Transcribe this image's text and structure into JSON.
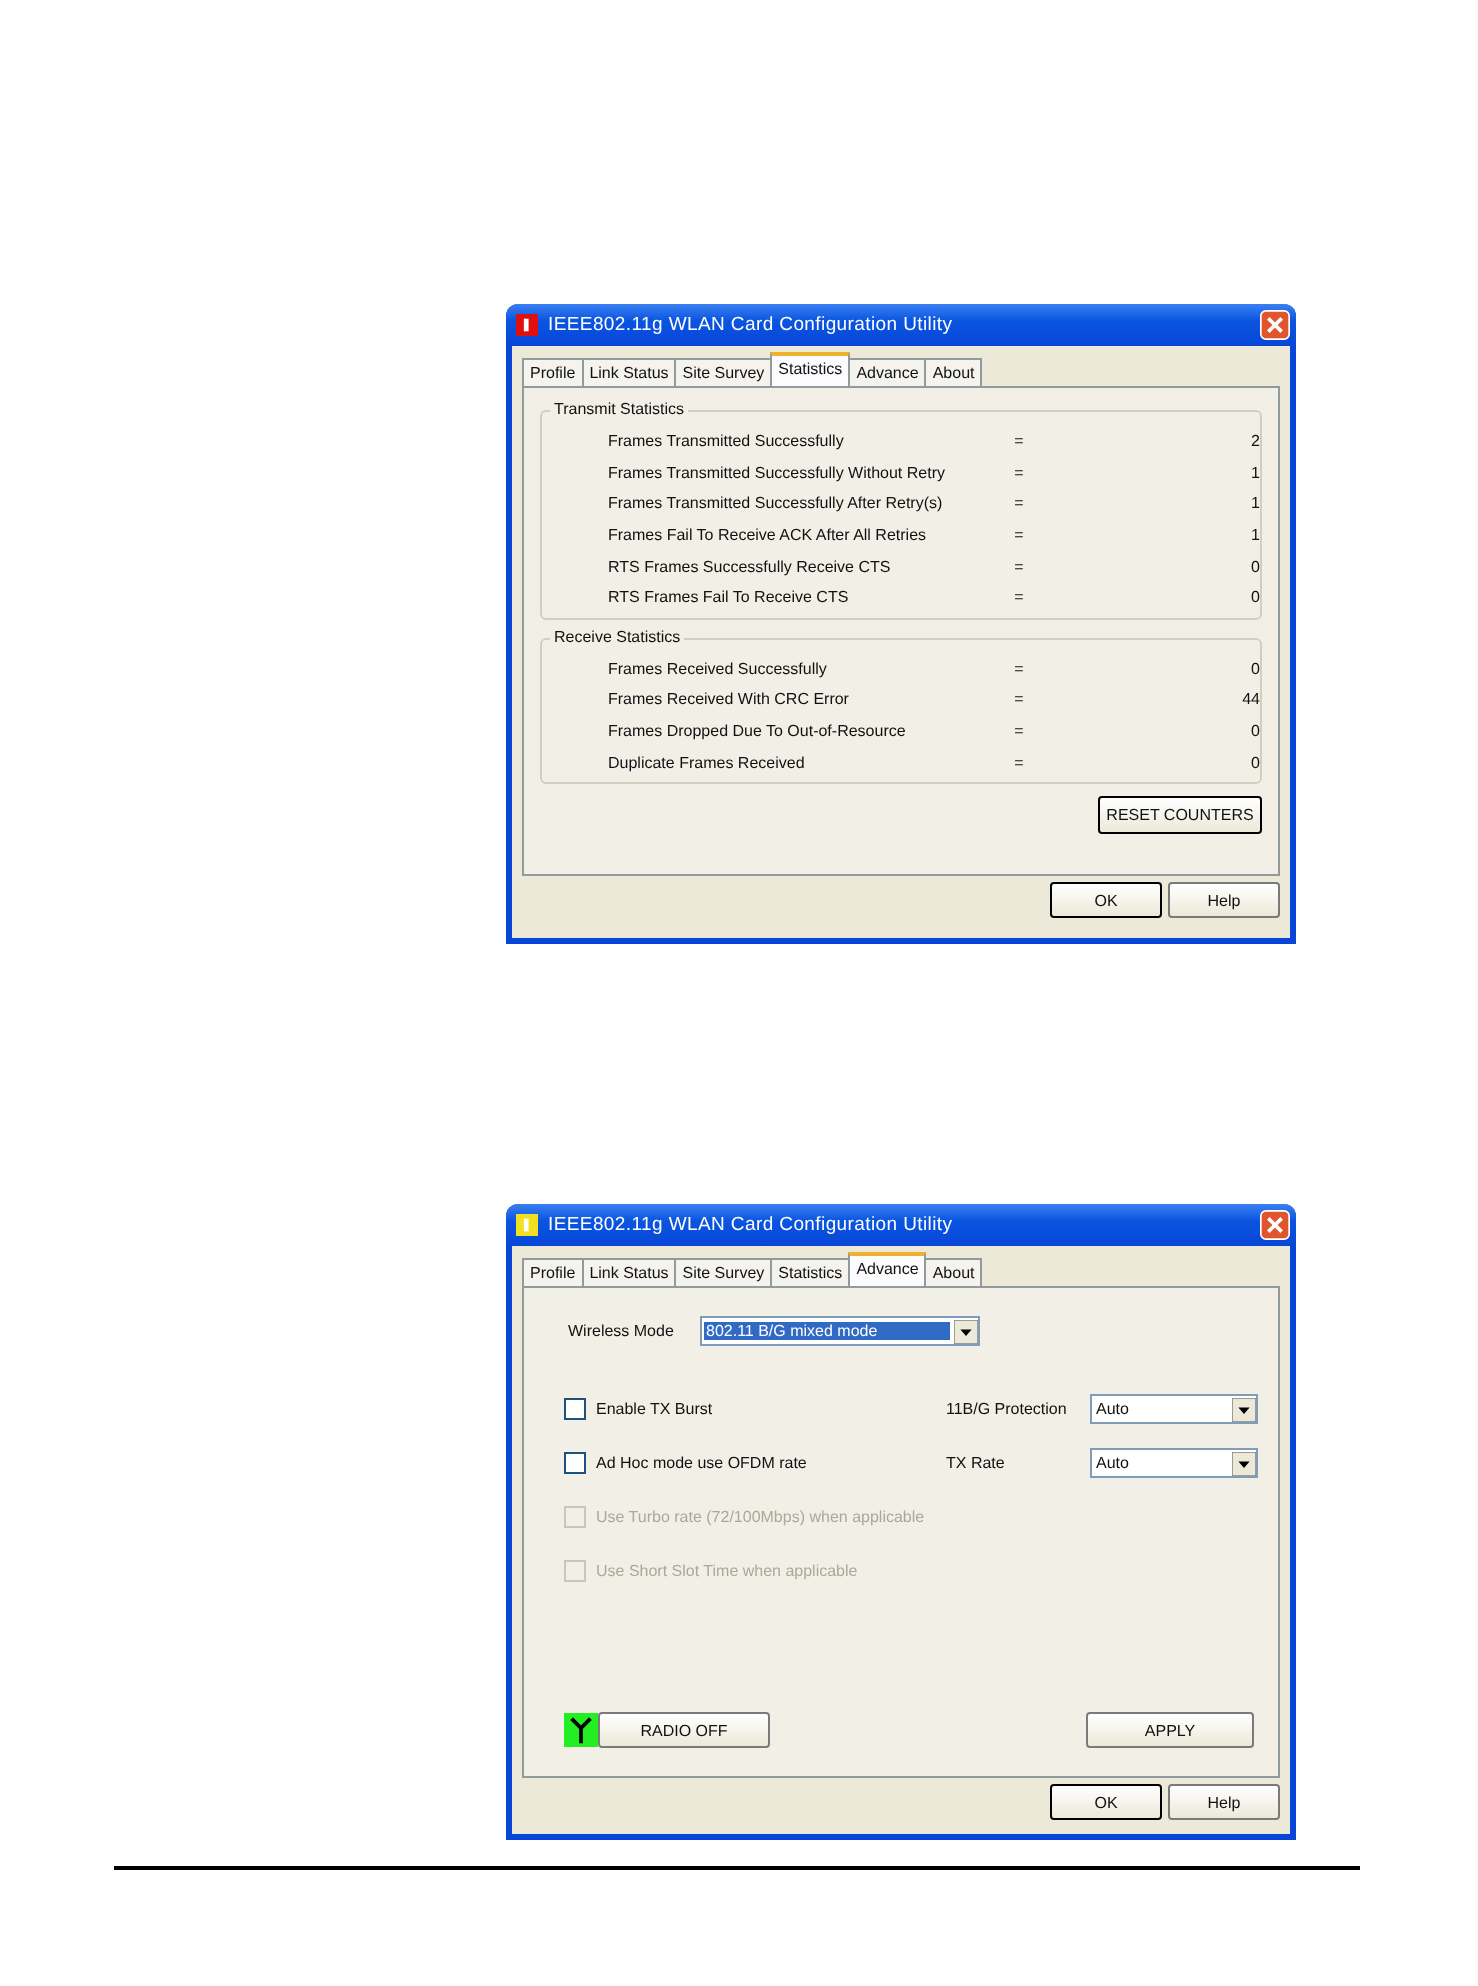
{
  "dialogs": [
    {
      "kind": "statistics",
      "title": "IEEE802.11g WLAN Card Configuration Utility",
      "color": "#e01010",
      "tabs": [
        {
          "label": "Profile",
          "selected": false
        },
        {
          "label": "Link Status",
          "selected": false
        },
        {
          "label": "Site Survey",
          "selected": false
        },
        {
          "label": "Statistics",
          "selected": true
        },
        {
          "label": "Advance",
          "selected": false
        },
        {
          "label": "About",
          "selected": false
        }
      ],
      "groups": [
        {
          "title": "Transmit Statistics",
          "rows": [
            {
              "label": "Frames Transmitted Successfully",
              "sign": "=",
              "value": "2"
            },
            {
              "label": "Frames Transmitted Successfully  Without Retry",
              "sign": "=",
              "value": "1"
            },
            {
              "label": "Frames Transmitted Successfully After Retry(s)",
              "sign": "=",
              "value": "1"
            },
            {
              "label": "Frames Fail To Receive ACK After All Retries",
              "sign": "=",
              "value": "1"
            },
            {
              "label": "RTS Frames Successfully Receive CTS",
              "sign": "=",
              "value": "0"
            },
            {
              "label": "RTS Frames Fail To Receive CTS",
              "sign": "=",
              "value": "0"
            }
          ]
        },
        {
          "title": "Receive Statistics",
          "rows": [
            {
              "label": "Frames Received Successfully",
              "sign": "=",
              "value": "0"
            },
            {
              "label": "Frames Received With CRC Error",
              "sign": "=",
              "value": "44"
            },
            {
              "label": "Frames Dropped Due To Out-of-Resource",
              "sign": "=",
              "value": "0"
            },
            {
              "label": "Duplicate Frames Received",
              "sign": "=",
              "value": "0"
            }
          ]
        }
      ],
      "reset_button": "RESET COUNTERS",
      "buttons": [
        "OK",
        "Help"
      ]
    },
    {
      "kind": "advance",
      "title": "IEEE802.11g WLAN Card Configuration Utility",
      "color": "#f0e020",
      "tabs": [
        {
          "label": "Profile",
          "selected": false
        },
        {
          "label": "Link Status",
          "selected": false
        },
        {
          "label": "Site Survey",
          "selected": false
        },
        {
          "label": "Statistics",
          "selected": false
        },
        {
          "label": "Advance",
          "selected": true
        },
        {
          "label": "About",
          "selected": false
        }
      ],
      "wireless_mode": {
        "label": "Wireless Mode",
        "value": "802.11 B/G mixed mode"
      },
      "options": [
        {
          "label": "Enable TX Burst",
          "checked": false,
          "disabled": false
        },
        {
          "label": "Ad Hoc mode use OFDM rate",
          "checked": false,
          "disabled": false
        },
        {
          "label": "Use Turbo rate (72/100Mbps) when applicable",
          "checked": false,
          "disabled": true
        },
        {
          "label": "Use Short Slot Time when applicable",
          "checked": false,
          "disabled": true
        }
      ],
      "selects": [
        {
          "label": "11B/G Protection",
          "value": "Auto"
        },
        {
          "label": "TX Rate",
          "value": "Auto"
        }
      ],
      "radio_button": "RADIO OFF",
      "apply_button": "APPLY",
      "buttons": [
        "OK",
        "Help"
      ]
    }
  ]
}
